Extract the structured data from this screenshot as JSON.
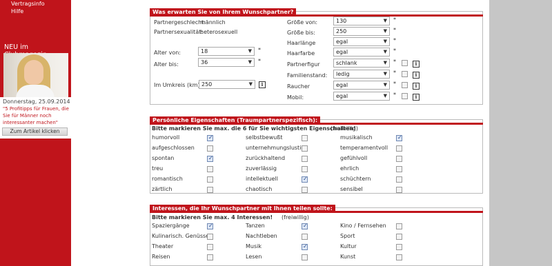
{
  "sidebar": {
    "links": [
      "Vertragsinfo",
      "Hilfe"
    ],
    "magazine_title": "NEU im Clubmagazin",
    "date": "Donnerstag, 25.09.2014",
    "teaser": "\"5 Profitipps für Frauen, die Sie für Männer noch interessanter machen\"",
    "button": "Zum Artikel klicken"
  },
  "wish": {
    "title": "Was erwarten Sie von Ihrem Wunschpartner?",
    "gender_label": "Partnergeschlecht:",
    "gender_value": "männlich",
    "orientation_label": "Partnersexualität:",
    "orientation_value": "heterosexuell",
    "age_from_label": "Alter von:",
    "age_from_value": "18",
    "age_to_label": "Alter bis:",
    "age_to_value": "36",
    "radius_label": "Im Umkreis (km):",
    "radius_value": "250",
    "size_from_label": "Größe von:",
    "size_from_value": "130",
    "size_to_label": "Größe bis:",
    "size_to_value": "250",
    "hair_length_label": "Haarlänge",
    "hair_length_value": "egal",
    "hair_color_label": "Haarfarbe",
    "hair_color_value": "egal",
    "figure_label": "Partnerfigur",
    "figure_value": "schlank",
    "status_label": "Familienstand:",
    "status_value": "ledig",
    "smoker_label": "Raucher",
    "smoker_value": "egal",
    "mobile_label": "Mobil:",
    "mobile_value": "egal",
    "required_mark": "*",
    "info_glyph": "i"
  },
  "traits": {
    "title": "Persönliche Eigenschaften (Traumpartnerspezifisch):",
    "instruction": "Bitte markieren Sie max. die 6 für Sie wichtigsten Eigenschaften!",
    "optional": "(freiwillig)",
    "items": [
      {
        "label": "humorvoll",
        "checked": true
      },
      {
        "label": "selbstbewußt",
        "checked": false
      },
      {
        "label": "musikalisch",
        "checked": true
      },
      {
        "label": "aufgeschlossen",
        "checked": false
      },
      {
        "label": "unternehmungslustig",
        "checked": false
      },
      {
        "label": "temperamentvoll",
        "checked": false
      },
      {
        "label": "spontan",
        "checked": true
      },
      {
        "label": "zurückhaltend",
        "checked": false
      },
      {
        "label": "gefühlvoll",
        "checked": false
      },
      {
        "label": "treu",
        "checked": false
      },
      {
        "label": "zuverlässig",
        "checked": false
      },
      {
        "label": "ehrlich",
        "checked": false
      },
      {
        "label": "romantisch",
        "checked": false
      },
      {
        "label": "intellektuell",
        "checked": true
      },
      {
        "label": "schüchtern",
        "checked": false
      },
      {
        "label": "zärtlich",
        "checked": false
      },
      {
        "label": "chaotisch",
        "checked": false
      },
      {
        "label": "sensibel",
        "checked": false
      }
    ]
  },
  "interests": {
    "title": "Interessen, die Ihr Wunschpartner mit Ihnen teilen sollte:",
    "instruction": "Bitte markieren Sie max. 4 Interessen!",
    "optional": "(freiwillig)",
    "items": [
      {
        "label": "Spaziergänge",
        "checked": true
      },
      {
        "label": "Tanzen",
        "checked": true
      },
      {
        "label": "Kino / Fernsehen",
        "checked": false
      },
      {
        "label": "Kulinarisch. Genüsse",
        "checked": false
      },
      {
        "label": "Nachtleben",
        "checked": false
      },
      {
        "label": "Sport",
        "checked": false
      },
      {
        "label": "Theater",
        "checked": false
      },
      {
        "label": "Musik",
        "checked": true
      },
      {
        "label": "Kultur",
        "checked": false
      },
      {
        "label": "Reisen",
        "checked": false
      },
      {
        "label": "Lesen",
        "checked": false
      },
      {
        "label": "Kunst",
        "checked": false
      }
    ]
  }
}
